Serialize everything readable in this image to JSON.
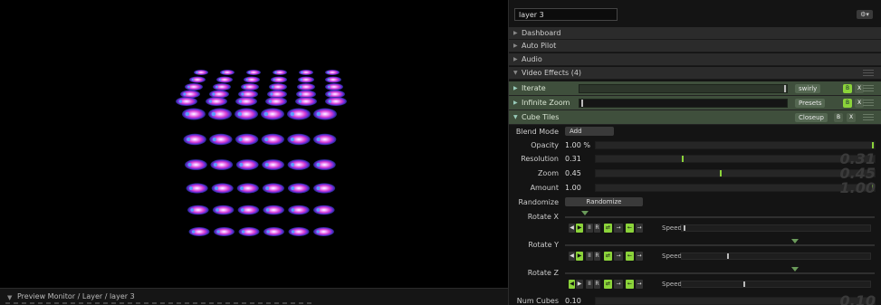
{
  "preview": {
    "footer_path": "Preview Monitor / Layer / layer 3"
  },
  "panel": {
    "layer_name": "layer 3",
    "gear_label": "⚙▾",
    "sections": [
      "Dashboard",
      "Auto Pilot",
      "Audio",
      "Video Effects (4)"
    ],
    "effects": [
      {
        "name": "Iterate",
        "tag": "swirly",
        "b1": "B",
        "b2": "X"
      },
      {
        "name": "Infinite Zoom",
        "tag": "Presets",
        "b1": "B",
        "b2": "X"
      },
      {
        "name": "Cube Tiles",
        "tag": "Closeup",
        "b1": "B",
        "b2": "X"
      }
    ],
    "blend_mode": {
      "label": "Blend Mode",
      "value": "Add"
    },
    "params": [
      {
        "label": "Opacity",
        "value": "1.00 %",
        "fraction": 1.0,
        "ghost": ""
      },
      {
        "label": "Resolution",
        "value": "0.31",
        "fraction": 0.31,
        "ghost": "0.31"
      },
      {
        "label": "Zoom",
        "value": "0.45",
        "fraction": 0.45,
        "ghost": "0.45"
      },
      {
        "label": "Amount",
        "value": "1.00",
        "fraction": 1.0,
        "ghost": "1.00"
      }
    ],
    "randomize": {
      "label": "Randomize",
      "button": "Randomize"
    },
    "rotates": [
      {
        "label": "Rotate X",
        "speed_label": "Speed"
      },
      {
        "label": "Rotate Y",
        "speed_label": "Speed"
      },
      {
        "label": "Rotate Z",
        "speed_label": "Speed"
      }
    ],
    "ctrl_glyphs": [
      "◀",
      "▶",
      "II",
      "R",
      "⇄",
      "→",
      "←",
      "→"
    ],
    "num_cubes": {
      "label": "Num Cubes",
      "value": "0.10",
      "ghost": "0.10"
    }
  },
  "colors": {
    "accent_green": "#8bd33a",
    "effect_row": "#3f4f3c",
    "tile_pink": "#e05cd6",
    "tile_blue": "#3f7cff"
  }
}
